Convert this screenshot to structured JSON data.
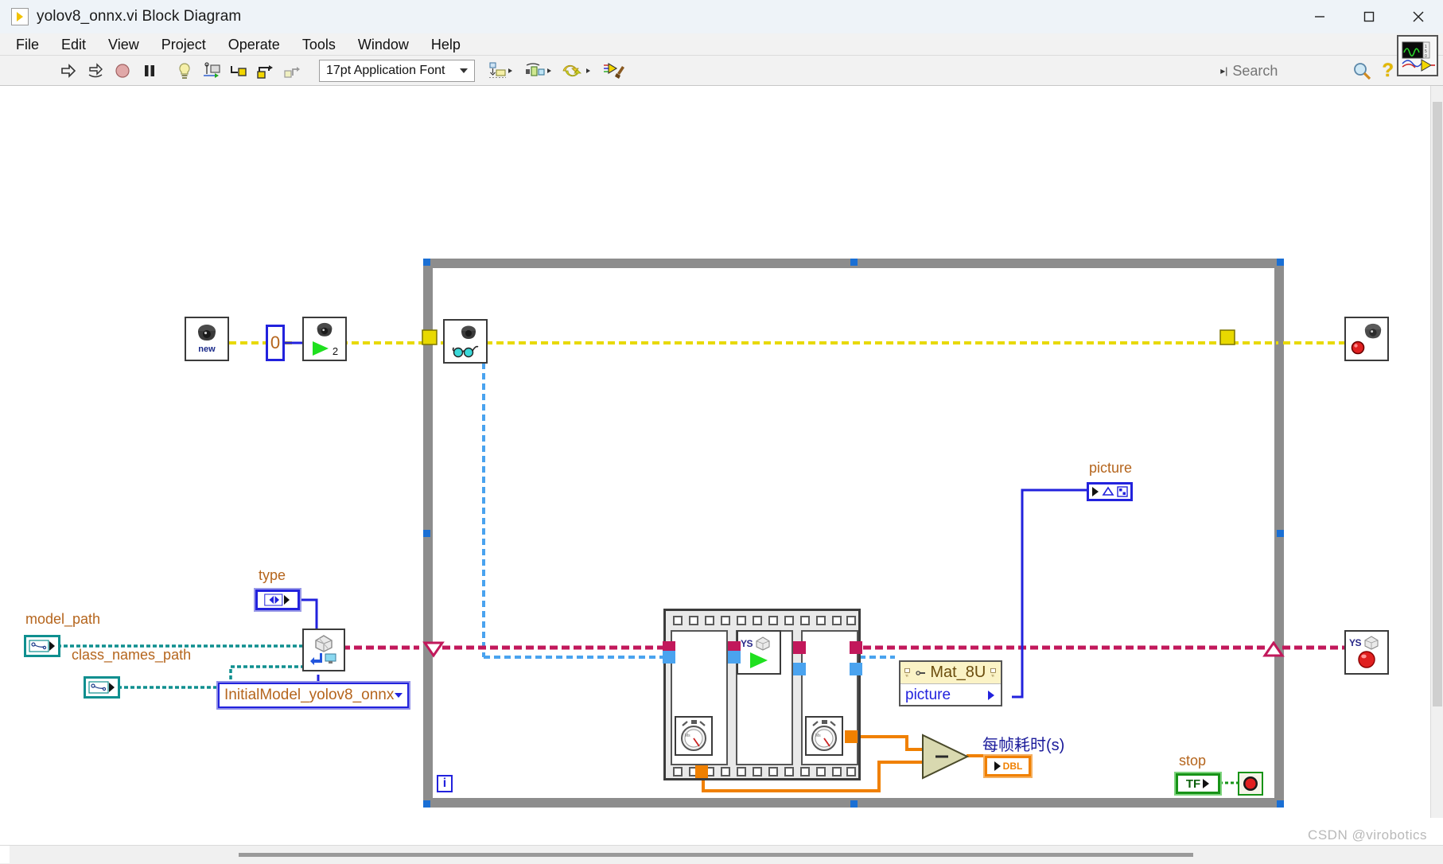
{
  "window": {
    "title": "yolov8_onnx.vi Block Diagram",
    "icon": "vi-run-arrow-icon",
    "controls": {
      "minimize": "minimize-icon",
      "maximize": "maximize-icon",
      "close": "close-icon"
    }
  },
  "menubar": {
    "items": [
      {
        "label": "File"
      },
      {
        "label": "Edit"
      },
      {
        "label": "View"
      },
      {
        "label": "Project"
      },
      {
        "label": "Operate"
      },
      {
        "label": "Tools"
      },
      {
        "label": "Window"
      },
      {
        "label": "Help"
      }
    ]
  },
  "toolbar": {
    "buttons": [
      {
        "name": "run-button",
        "icon": "right-arrow-icon"
      },
      {
        "name": "run-continuously-button",
        "icon": "run-continuous-icon"
      },
      {
        "name": "abort-execution-button",
        "icon": "stop-octagon-icon"
      },
      {
        "name": "pause-button",
        "icon": "pause-icon"
      },
      {
        "name": "highlight-execution-button",
        "icon": "lightbulb-icon"
      },
      {
        "name": "retain-wire-values-button",
        "icon": "probe-icon"
      },
      {
        "name": "step-into-button",
        "icon": "step-into-icon"
      },
      {
        "name": "step-over-button",
        "icon": "step-over-icon"
      },
      {
        "name": "step-out-button",
        "icon": "step-out-icon"
      }
    ],
    "font_selector": {
      "value": "17pt Application Font"
    },
    "align_menu": {
      "name": "align-objects-menu",
      "icon": "align-objects-icon"
    },
    "distribute_menu": {
      "name": "distribute-objects-menu",
      "icon": "distribute-objects-icon"
    },
    "reorder_menu": {
      "name": "reorder-menu",
      "icon": "reorder-icon"
    },
    "cleanup_button": {
      "name": "clean-up-diagram-button",
      "icon": "cleanup-diagram-icon"
    },
    "search": {
      "placeholder": "Search",
      "value": "",
      "icon": "magnifier-icon"
    },
    "help_button": {
      "label": "?",
      "name": "context-help-button"
    },
    "vi_icon": {
      "name": "vi-icon-pane",
      "icon": "waveform-vi-icon"
    }
  },
  "diagram": {
    "nodes": [
      {
        "id": "camera-new",
        "name": "camera-new-node",
        "icon": "camera-icon",
        "sub": "new"
      },
      {
        "id": "const-zero",
        "name": "camera-index-constant",
        "value": "0"
      },
      {
        "id": "camera-open",
        "name": "camera-open-node",
        "icon": "camera-play-icon",
        "sub": "2"
      },
      {
        "id": "camera-read",
        "name": "camera-read-node",
        "icon": "camera-glasses-icon"
      },
      {
        "id": "camera-close",
        "name": "camera-close-node",
        "icon": "camera-stop-icon"
      },
      {
        "id": "model-init",
        "name": "initial-model-node",
        "icon": "model-load-icon"
      },
      {
        "id": "model-infer",
        "name": "yolov8-inference-node",
        "icon": "ys-run-icon",
        "sub": "YS"
      },
      {
        "id": "model-close",
        "name": "model-close-node",
        "icon": "ys-stop-icon",
        "sub": "YS"
      },
      {
        "id": "tick-start",
        "name": "tick-count-start-node",
        "icon": "stopwatch-icon"
      },
      {
        "id": "tick-end",
        "name": "tick-count-end-node",
        "icon": "stopwatch-icon"
      },
      {
        "id": "subtract",
        "name": "subtract-function",
        "icon": "subtract-icon",
        "symbol": "–"
      }
    ],
    "labels": {
      "model_path": "model_path",
      "class_names_path": "class_names_path",
      "type": "type",
      "picture": "picture",
      "frame_time": "每帧耗时(s)",
      "stop": "stop"
    },
    "controls": {
      "model_path_terminal": {
        "name": "model-path-terminal",
        "datatype": "path"
      },
      "class_names_terminal": {
        "name": "class-names-path-terminal",
        "datatype": "path"
      },
      "type_terminal": {
        "name": "type-enum-terminal",
        "datatype": "enum"
      },
      "model_combo": {
        "name": "initial-model-combo-box",
        "value": "InitialModel_yolov8_onnx",
        "options": [
          "InitialModel_yolov8_onnx"
        ]
      },
      "stop_terminal": {
        "name": "stop-boolean-terminal",
        "value": "TF",
        "datatype": "boolean"
      },
      "stop_constant": {
        "name": "loop-stop-condition",
        "icon": "stop-sign-icon"
      },
      "picture_indicator": {
        "name": "picture-indicator-terminal",
        "datatype": "picture"
      },
      "frame_time_indicator": {
        "name": "frame-time-indicator-terminal",
        "value": "DBL",
        "datatype": "double"
      },
      "iteration_terminal": {
        "name": "loop-iteration-terminal",
        "value": "i"
      }
    },
    "property_node": {
      "name": "mat-8u-property-node",
      "title": "Mat_8U",
      "property": "picture",
      "reference_icon": "reference-icon"
    },
    "structures": {
      "while_loop": {
        "name": "while-loop-structure"
      },
      "flat_sequence": {
        "name": "flat-sequence-structure",
        "frames": 3
      }
    },
    "colors": {
      "error_wire": "#c2185b",
      "camera_ref_wire": "#e8d900",
      "image_wire": "#4aa3ef",
      "path_wire": "#0f8f8f",
      "numeric_wire": "#f08000",
      "enum_wire": "#2222dd",
      "boolean_wire": "#179317",
      "loop_border": "#8d8d8d"
    }
  },
  "status": {
    "watermark": "CSDN @virobotics"
  }
}
